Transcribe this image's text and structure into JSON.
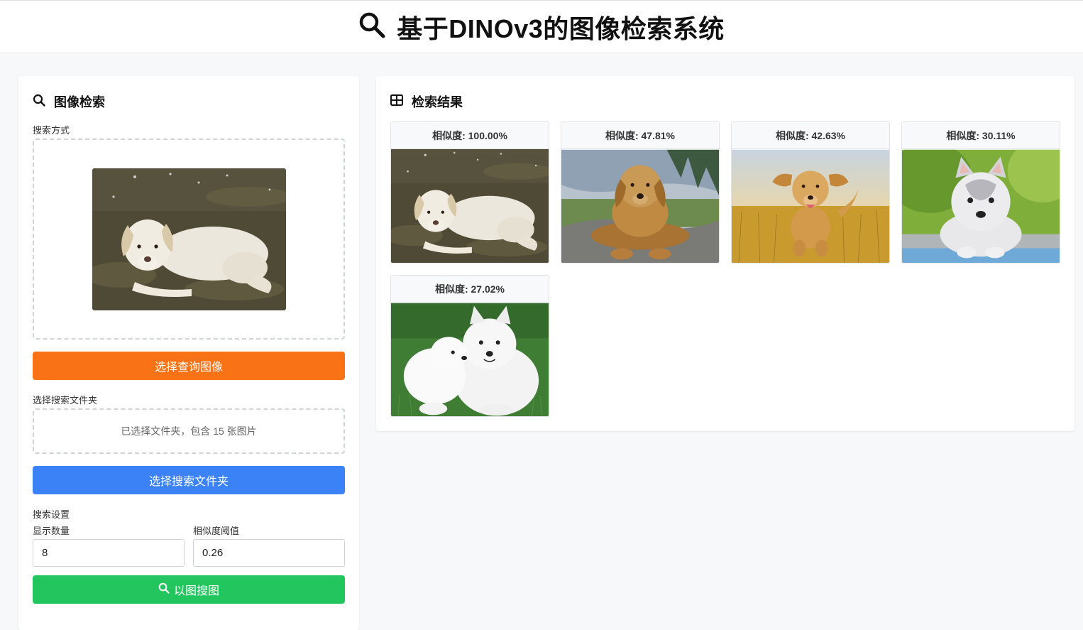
{
  "header": {
    "title": "基于DINOv3的图像检索系统",
    "icon": "search-icon"
  },
  "left": {
    "title": "图像检索",
    "search_mode_label": "搜索方式",
    "select_query_button": "选择查询图像",
    "folder_label": "选择搜索文件夹",
    "folder_info": "已选择文件夹，包含 15 张图片",
    "select_folder_button": "选择搜索文件夹",
    "settings_label": "搜索设置",
    "count_label": "显示数量",
    "count_value": "8",
    "threshold_label": "相似度阈值",
    "threshold_value": "0.26",
    "search_button": "以图搜图"
  },
  "right": {
    "title": "检索结果",
    "results": [
      {
        "label": "相似度: 100.00%",
        "image": "white-dog-lying-on-grass"
      },
      {
        "label": "相似度: 47.81%",
        "image": "golden-labrador-on-rock"
      },
      {
        "label": "相似度: 42.63%",
        "image": "golden-retriever-running-in-field"
      },
      {
        "label": "相似度: 30.11%",
        "image": "husky-puppy"
      },
      {
        "label": "相似度: 27.02%",
        "image": "samoyed-dogs-on-grass"
      }
    ]
  },
  "colors": {
    "orange": "#f97316",
    "blue": "#3b82f6",
    "green": "#22c55e"
  }
}
